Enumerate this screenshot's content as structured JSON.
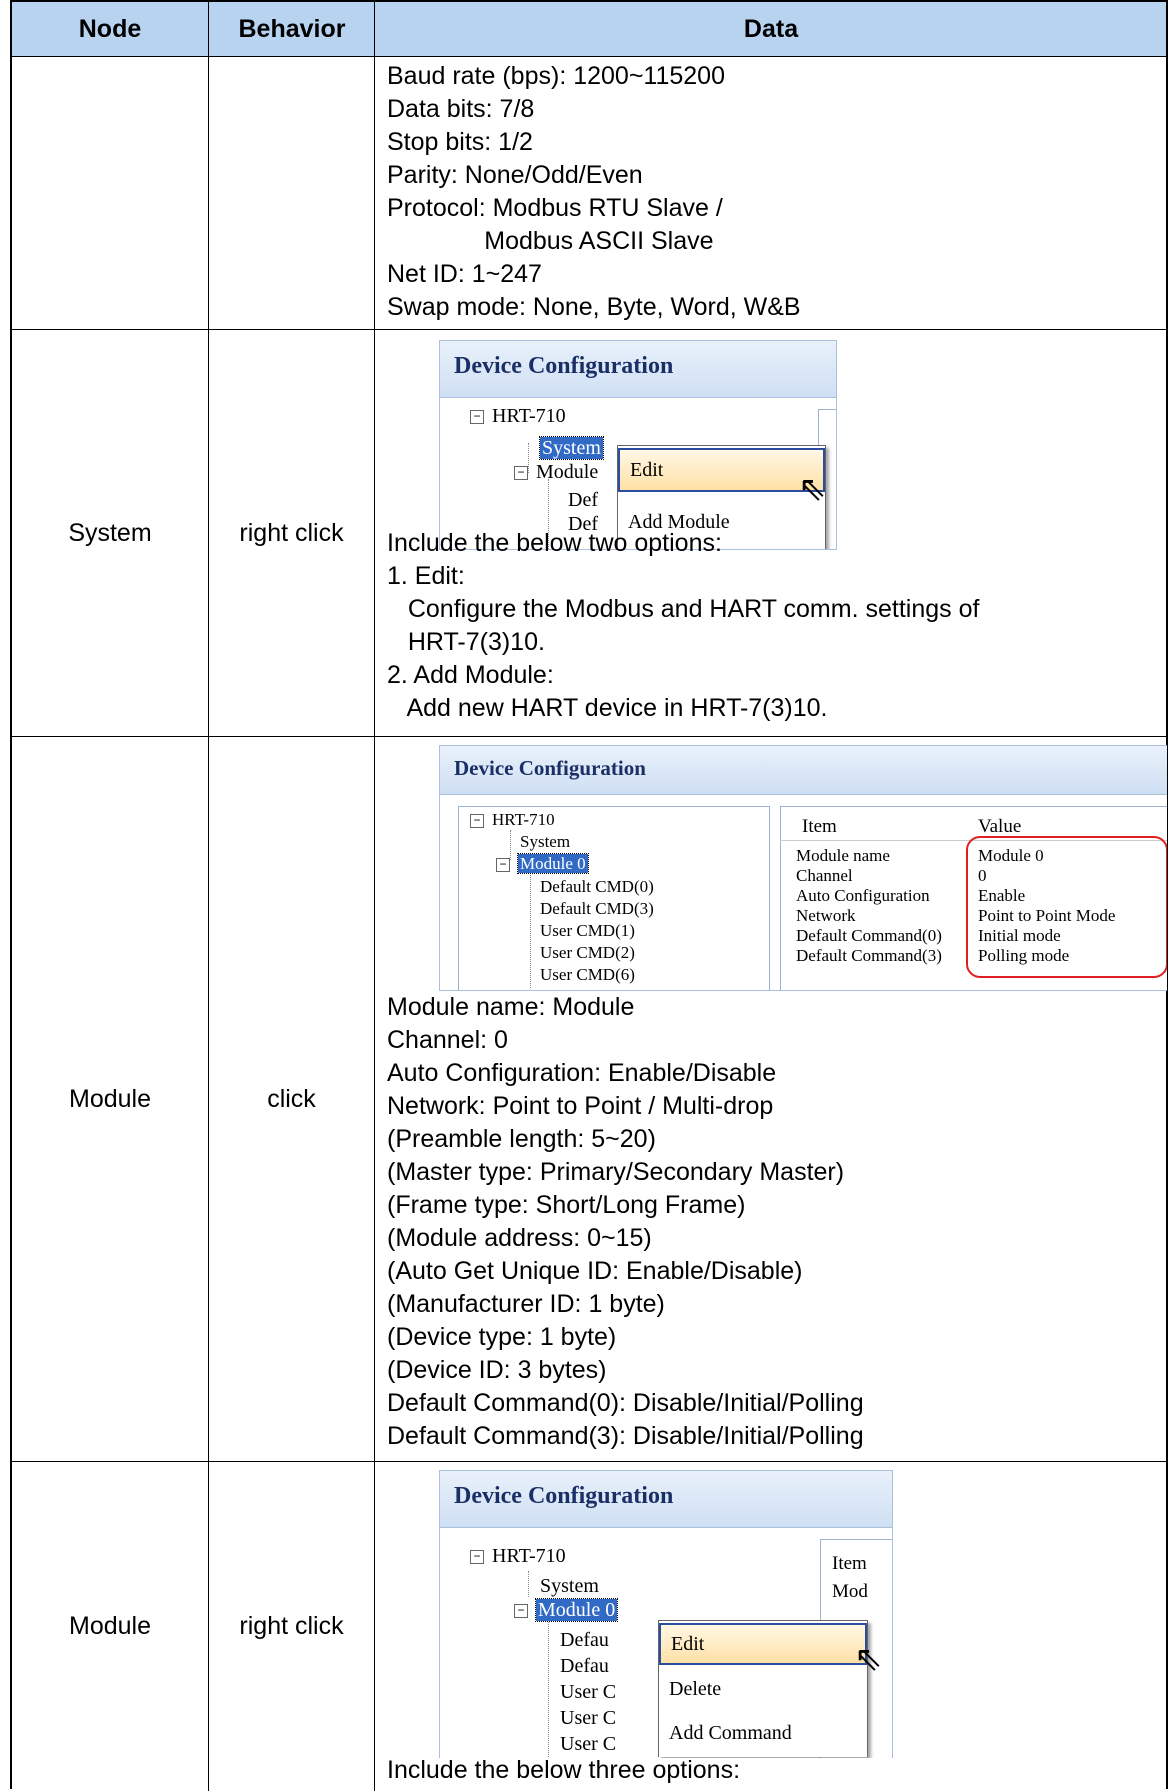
{
  "table": {
    "headers": {
      "node": "Node",
      "behavior": "Behavior",
      "data": "Data"
    },
    "row1": {
      "node": "",
      "behavior": "",
      "lines": [
        "Baud rate (bps): 1200~115200",
        "Data bits: 7/8",
        "Stop bits: 1/2",
        "Parity: None/Odd/Even",
        "Protocol: Modbus RTU Slave /",
        "              Modbus ASCII Slave",
        "Net ID: 1~247",
        "Swap mode: None, Byte, Word, W&B"
      ]
    },
    "row2": {
      "node": "System",
      "behavior": "right click",
      "shot": {
        "title": "Device Configuration",
        "root": "HRT-710",
        "system": "System",
        "module": "Module",
        "child1": "Def",
        "child2": "Def",
        "menu": [
          "Edit",
          "Add Module"
        ]
      },
      "lines": [
        "Include the below two options:",
        "1. Edit:",
        "   Configure the Modbus and HART comm. settings of",
        "   HRT-7(3)10.",
        "2. Add Module:",
        "   Add new HART device in HRT-7(3)10."
      ]
    },
    "row3": {
      "node": "Module",
      "behavior": "click",
      "shot": {
        "title": "Device Configuration",
        "root": "HRT-710",
        "system": "System",
        "module": "Module 0",
        "children": [
          "Default CMD(0)",
          "Default CMD(3)",
          "User CMD(1)",
          "User CMD(2)",
          "User CMD(6)"
        ],
        "col_item": "Item",
        "col_value": "Value",
        "props": [
          {
            "item": "Module name",
            "value": "Module 0"
          },
          {
            "item": "Channel",
            "value": "0"
          },
          {
            "item": "Auto Configuration",
            "value": "Enable"
          },
          {
            "item": "Network",
            "value": "Point to Point Mode"
          },
          {
            "item": "Default Command(0)",
            "value": "Initial mode"
          },
          {
            "item": "Default Command(3)",
            "value": "Polling mode"
          }
        ]
      },
      "lines": [
        "Module name: Module",
        "Channel: 0",
        "Auto Configuration: Enable/Disable",
        "Network: Point to Point / Multi-drop",
        "(Preamble length: 5~20)",
        "(Master type: Primary/Secondary Master)",
        "(Frame type: Short/Long Frame)",
        "(Module address: 0~15)",
        "(Auto Get Unique ID: Enable/Disable)",
        "(Manufacturer ID: 1 byte)",
        "(Device type: 1 byte)",
        "(Device ID: 3 bytes)",
        "Default Command(0): Disable/Initial/Polling",
        "Default Command(3): Disable/Initial/Polling"
      ]
    },
    "row4": {
      "node": "Module",
      "behavior": "right click",
      "shot": {
        "title": "Device Configuration",
        "root": "HRT-710",
        "system": "System",
        "module": "Module 0",
        "children": [
          "Defau",
          "Defau",
          "User C",
          "User C",
          "User C"
        ],
        "col_item": "Item",
        "col_value1": "Mod",
        "menu": [
          "Edit",
          "Delete",
          "Add Command"
        ]
      },
      "lines": [
        "Include the below three options:"
      ]
    }
  }
}
